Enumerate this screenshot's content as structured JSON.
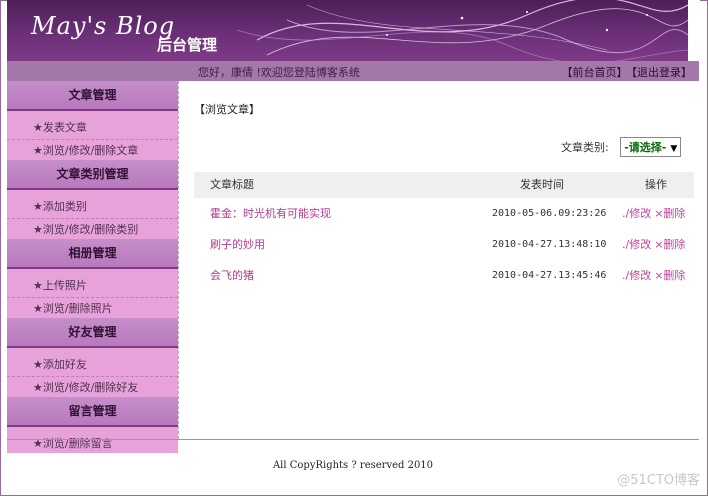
{
  "header": {
    "logo": "May's Blog",
    "subtitle": "后台管理"
  },
  "infobar": {
    "welcome": "您好，康倩 !欢迎您登陆博客系统",
    "links": [
      "【前台首页】",
      "【退出登录】"
    ]
  },
  "sidebar": {
    "sections": [
      {
        "title": "文章管理",
        "items": [
          "★发表文章",
          "★浏览/修改/删除文章"
        ]
      },
      {
        "title": "文章类别管理",
        "items": [
          "★添加类别",
          "★浏览/修改/删除类别"
        ]
      },
      {
        "title": "相册管理",
        "items": [
          "★上传照片",
          "★浏览/删除照片"
        ]
      },
      {
        "title": "好友管理",
        "items": [
          "★添加好友",
          "★浏览/修改/删除好友"
        ]
      },
      {
        "title": "留言管理",
        "items": [
          "★浏览/删除留言"
        ]
      }
    ]
  },
  "main": {
    "breadcrumb": "【浏览文章】",
    "category_label": "文章类别:",
    "category_select": "-请选择-",
    "columns": [
      "文章标题",
      "发表时间",
      "操作"
    ],
    "rows": [
      {
        "title": "霍金：时光机有可能实现",
        "time": "2010-05-06.09:23:26"
      },
      {
        "title": "刷子的妙用",
        "time": "2010-04-27.13:48:10"
      },
      {
        "title": "会飞的猪",
        "time": "2010-04-27.13:45:46"
      }
    ],
    "op_edit": "./修改",
    "op_delete": "×删除"
  },
  "footer": {
    "copyright": "All CopyRights ? reserved 2010"
  },
  "watermark": "@51CTO博客",
  "colors": {
    "header": "#6b2f77",
    "infobar": "#a377a9",
    "sidebar_item_bg": "#e7a2d9",
    "link": "#b03b8f"
  }
}
